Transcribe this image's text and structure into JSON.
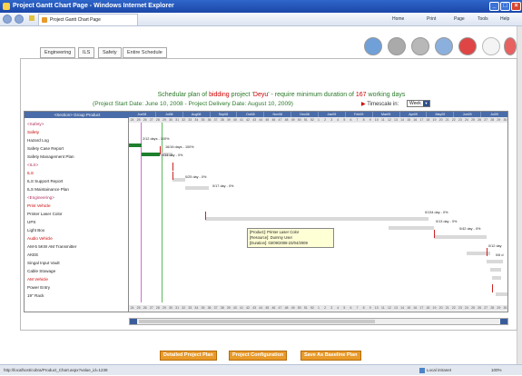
{
  "window": {
    "title": "Project Gantt Chart Page - Windows Internet Explorer",
    "min": "_",
    "max": "□",
    "close": "×"
  },
  "browser": {
    "tab_title": "Project Gantt Chart Page",
    "home": "Home",
    "print": "Print",
    "page": "Page",
    "tools": "Tools",
    "help": "Help"
  },
  "tabs": [
    "Engineering",
    "ILS",
    "Safety",
    "Entire Schedule"
  ],
  "headline": {
    "prefix": "Schedular plan of ",
    "bidding": "bidding",
    "mid": " project '",
    "project": "Deyu",
    "tail": "' - require minimum duration of ",
    "days": "167",
    "suffix": " working days"
  },
  "subline": {
    "start_label": "(Project Start Date: June 10, 2008 - Project Delivery Date: August 10, 2009)",
    "timescale_label": "Timescale in:",
    "timescale_value": "Week"
  },
  "grid": {
    "column_header": "<Section> Group Product",
    "rows": [
      {
        "text": "<Safety>",
        "color": "#b03060"
      },
      {
        "text": "Safety",
        "color": "#cc0000"
      },
      {
        "text": "Hazard Log",
        "color": "#222222"
      },
      {
        "text": "Safety Case Report",
        "color": "#222222"
      },
      {
        "text": "Safety Management Plan",
        "color": "#222222"
      },
      {
        "text": "<ILS>",
        "color": "#b03060"
      },
      {
        "text": "ILS",
        "color": "#cc0000"
      },
      {
        "text": "ILS Support Report",
        "color": "#222222"
      },
      {
        "text": "ILS Maintainance Plan",
        "color": "#222222"
      },
      {
        "text": "<Engineering>",
        "color": "#b03060"
      },
      {
        "text": "Print Vehicle",
        "color": "#cc0000"
      },
      {
        "text": "Printer Laser Color",
        "color": "#222222"
      },
      {
        "text": "UPS",
        "color": "#222222"
      },
      {
        "text": "Light Box",
        "color": "#222222"
      },
      {
        "text": "Audio Vehicle",
        "color": "#cc0000"
      },
      {
        "text": "AM-5 5KW AM Transmitter",
        "color": "#222222"
      },
      {
        "text": "AKEE",
        "color": "#222222"
      },
      {
        "text": "Singal Input Vault",
        "color": "#222222"
      },
      {
        "text": "Cable Stowage",
        "color": "#222222"
      },
      {
        "text": "AM Vehicle",
        "color": "#cc0000"
      },
      {
        "text": "Power Entry",
        "color": "#222222"
      },
      {
        "text": "19\" Rack",
        "color": "#222222"
      }
    ]
  },
  "timeline": {
    "months": [
      "Jun08",
      "Jul08",
      "Aug08",
      "Sep08",
      "Oct08",
      "Nov08",
      "Dec08",
      "Jan09",
      "Feb09",
      "Mar09",
      "Apr09",
      "May09",
      "Jun09",
      "Jul09"
    ],
    "weeks": [
      "24",
      "25",
      "26",
      "27",
      "28",
      "29",
      "30",
      "31",
      "32",
      "33",
      "34",
      "35",
      "36",
      "37",
      "38",
      "39",
      "40",
      "41",
      "42",
      "43",
      "44",
      "45",
      "46",
      "47",
      "48",
      "49",
      "50",
      "51",
      "52",
      "1",
      "2",
      "3",
      "4",
      "5",
      "6",
      "7",
      "8",
      "9",
      "10",
      "11",
      "12",
      "13",
      "14",
      "15",
      "16",
      "17",
      "18",
      "19",
      "20",
      "21",
      "22",
      "23",
      "24",
      "25",
      "26",
      "27",
      "28",
      "29",
      "30"
    ]
  },
  "bar_labels": [
    "2/12 days - 100%",
    "16/16 days - 100%",
    "0/14 day - 0%",
    "0/25 day - 0%",
    "0/17 day - 0%",
    "0/134 day - 0%",
    "0/13 day - 0%",
    "0/42 day - 0%",
    "0/12 day",
    "0/6 d"
  ],
  "tooltip": {
    "product_label": "[Product]:",
    "product": "Printer Laser Color",
    "resource_label": "[Resource]:",
    "resource": "Dummy User",
    "duration_label": "[Duration]:",
    "duration": "03/09/2008-23/04/2009"
  },
  "buttons": [
    "Detailed Project Plan",
    "Project Configuration",
    "Save As Baseline Plan"
  ],
  "status": {
    "url": "http://localhost/cobra/Product_Chart.aspx?value_id=1239",
    "zone": "Local intranet",
    "zoom": "100%"
  }
}
